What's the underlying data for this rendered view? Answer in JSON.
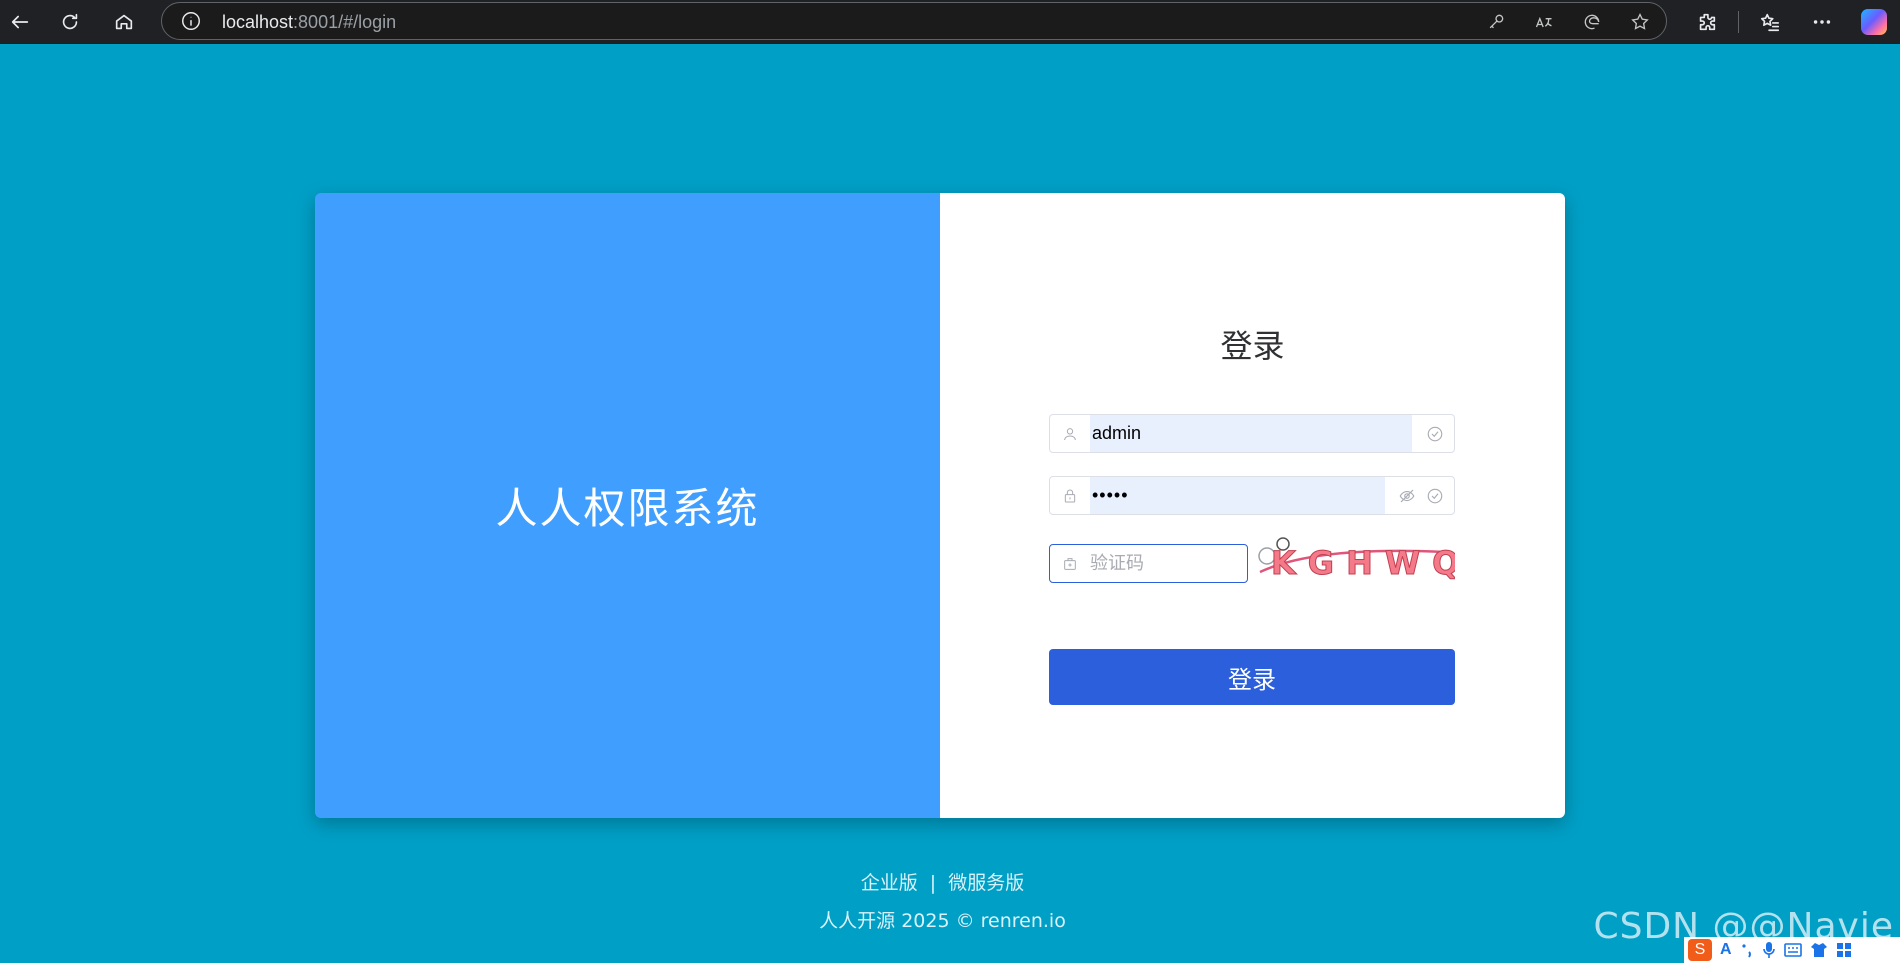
{
  "browser": {
    "url_host": "localhost",
    "url_rest": ":8001/#/login"
  },
  "brand": {
    "title": "人人权限系统"
  },
  "login": {
    "title": "登录",
    "username_value": "admin",
    "password_mask": "•••••",
    "captcha_placeholder": "验证码",
    "captcha_text": "KGHWQ",
    "submit_label": "登录"
  },
  "footer": {
    "link_enterprise": "企业版",
    "separator": "|",
    "link_microservice": "微服务版",
    "copyright": "人人开源 2025 © renren.io"
  },
  "watermark": "CSDN @@Navie",
  "ime": {
    "logo": "S",
    "mode": "A"
  },
  "colors": {
    "page_background": "#009fc6",
    "brand_panel": "#409eff",
    "primary_button": "#2c5fdc",
    "autofill": "#e8f0fe"
  }
}
